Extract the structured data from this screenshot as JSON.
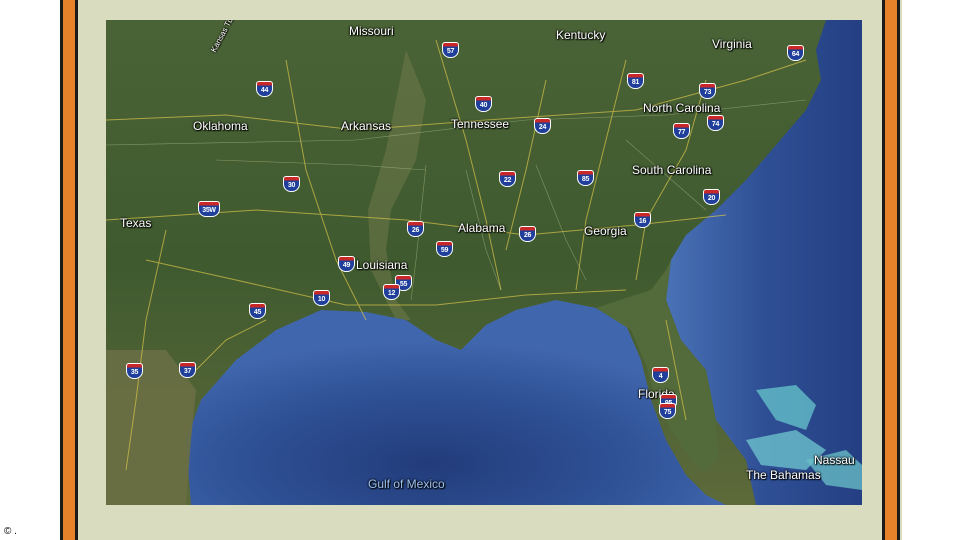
{
  "map": {
    "states": [
      "Missouri",
      "Kentucky",
      "Virginia",
      "Oklahoma",
      "Arkansas",
      "Tennessee",
      "North Carolina",
      "South Carolina",
      "Texas",
      "Alabama",
      "Georgia",
      "Louisiana",
      "Florida"
    ],
    "water": [
      "Gulf of Mexico"
    ],
    "places": [
      "Nassau",
      "The Bahamas"
    ],
    "river_label": "Kansas Turnpike",
    "interstates": [
      "57",
      "64",
      "81",
      "73",
      "44",
      "40",
      "24",
      "77",
      "74",
      "30",
      "22",
      "85",
      "35W",
      "20",
      "26",
      "16",
      "95",
      "59",
      "55",
      "49",
      "10",
      "12",
      "45",
      "35",
      "37",
      "4",
      "75"
    ]
  },
  "footer": {
    "copyright": "© ."
  },
  "colors": {
    "frame_bar": "#e8822a",
    "slide_bg": "#d9dcbe",
    "land": "#3c5a2e",
    "water": "#2a4a8c",
    "road": "#d8c44a",
    "shield_red": "#c82828",
    "shield_blue": "#1f3f9a"
  }
}
